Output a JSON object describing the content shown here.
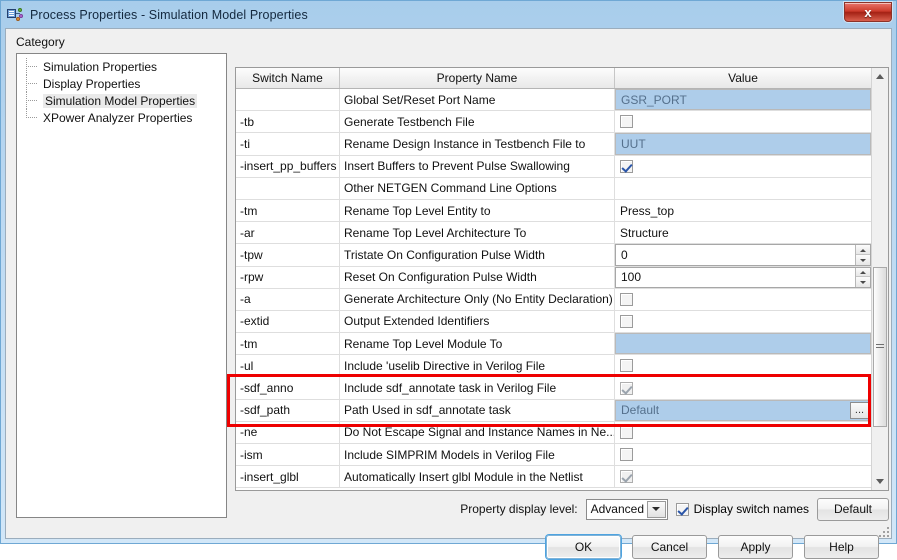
{
  "window": {
    "title": "Process Properties - Simulation Model Properties",
    "icon": "process-properties-icon",
    "close_label": "x"
  },
  "sidebar": {
    "label": "Category",
    "items": [
      {
        "label": "Simulation Properties",
        "selected": false
      },
      {
        "label": "Display Properties",
        "selected": false
      },
      {
        "label": "Simulation Model Properties",
        "selected": true
      },
      {
        "label": "XPower Analyzer Properties",
        "selected": false
      }
    ]
  },
  "grid": {
    "columns": [
      "Switch Name",
      "Property Name",
      "Value"
    ],
    "rows": [
      {
        "switch": "",
        "property": "Global Set/Reset Port Name",
        "type": "edit",
        "value": "GSR_PORT"
      },
      {
        "switch": "-tb",
        "property": "Generate Testbench File",
        "type": "checkbox",
        "checked": false,
        "disabled": false
      },
      {
        "switch": "-ti",
        "property": "Rename Design Instance in Testbench File to",
        "type": "edit",
        "value": "UUT"
      },
      {
        "switch": "-insert_pp_buffers",
        "property": "Insert Buffers to Prevent Pulse Swallowing",
        "type": "checkbox",
        "checked": true,
        "disabled": false
      },
      {
        "switch": "",
        "property": "Other NETGEN Command Line Options",
        "type": "blank",
        "value": ""
      },
      {
        "switch": "-tm",
        "property": "Rename Top Level Entity to",
        "type": "text",
        "value": "Press_top"
      },
      {
        "switch": "-ar",
        "property": "Rename Top Level Architecture To",
        "type": "text",
        "value": "Structure"
      },
      {
        "switch": "-tpw",
        "property": "Tristate On Configuration Pulse Width",
        "type": "spinner",
        "value": "0"
      },
      {
        "switch": "-rpw",
        "property": "Reset On Configuration Pulse Width",
        "type": "spinner",
        "value": "100"
      },
      {
        "switch": "-a",
        "property": "Generate Architecture Only (No Entity Declaration)",
        "type": "checkbox",
        "checked": false,
        "disabled": false
      },
      {
        "switch": "-extid",
        "property": "Output Extended Identifiers",
        "type": "checkbox",
        "checked": false,
        "disabled": false
      },
      {
        "switch": "-tm",
        "property": "Rename Top Level Module To",
        "type": "edit",
        "value": ""
      },
      {
        "switch": "-ul",
        "property": "Include 'uselib Directive in Verilog File",
        "type": "checkbox",
        "checked": false,
        "disabled": false
      },
      {
        "switch": "-sdf_anno",
        "property": "Include sdf_annotate task in Verilog File",
        "type": "checkbox",
        "checked": true,
        "disabled": true
      },
      {
        "switch": "-sdf_path",
        "property": "Path Used in sdf_annotate task",
        "type": "edit-browse",
        "value": "Default",
        "browse_label": "..."
      },
      {
        "switch": "-ne",
        "property": "Do Not Escape Signal and Instance Names in Ne...",
        "type": "checkbox",
        "checked": false,
        "disabled": false
      },
      {
        "switch": "-ism",
        "property": "Include SIMPRIM Models in Verilog File",
        "type": "checkbox",
        "checked": false,
        "disabled": false
      },
      {
        "switch": "-insert_glbl",
        "property": "Automatically Insert glbl Module in the Netlist",
        "type": "checkbox",
        "checked": true,
        "disabled": true
      }
    ],
    "highlight": {
      "color": "#ee0000",
      "from_row": 13,
      "to_row": 14
    }
  },
  "footer": {
    "display_level_label": "Property display level:",
    "display_level_value": "Advanced",
    "switch_names_label": "Display switch names",
    "switch_names_checked": true,
    "default_button": "Default"
  },
  "actions": {
    "ok": "OK",
    "cancel": "Cancel",
    "apply": "Apply",
    "help": "Help"
  },
  "colors": {
    "accent": "#aecdea",
    "highlight": "#ee0000",
    "titlebar": "#a8cdeb",
    "close": "#cd3b2c"
  }
}
